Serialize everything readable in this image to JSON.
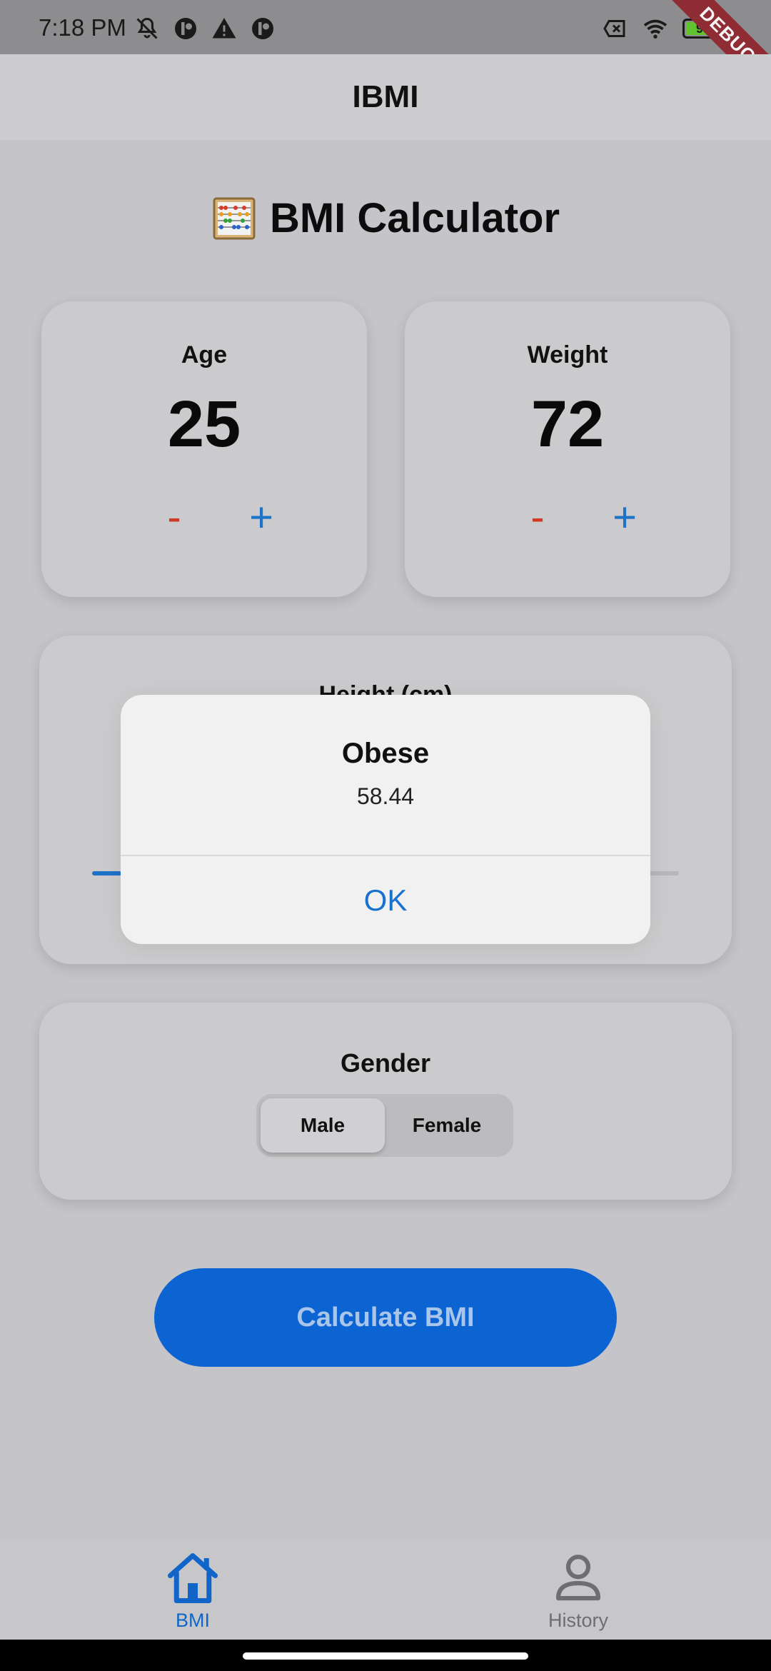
{
  "status_bar": {
    "time": "7:18 PM",
    "battery": "99",
    "battery_color": "#5ec32c",
    "left_icons": [
      "notifications-muted-icon",
      "app-notification-icon",
      "warning-icon",
      "app-notification-icon"
    ],
    "right_icons": [
      "no-sim-icon",
      "wifi-icon",
      "battery-icon"
    ]
  },
  "debug_banner": "DEBUG",
  "app_bar": {
    "title": "IBMI"
  },
  "page": {
    "title": "BMI Calculator",
    "title_icon": "abacus-icon"
  },
  "age_card": {
    "label": "Age",
    "value": "25",
    "minus_label": "-",
    "plus_label": "+"
  },
  "weight_card": {
    "label": "Weight",
    "value": "72",
    "minus_label": "-",
    "plus_label": "+"
  },
  "height_card": {
    "label": "Height (cm)",
    "slider_fraction": 0.05
  },
  "gender_card": {
    "label": "Gender",
    "options": [
      "Male",
      "Female"
    ],
    "selected": "Male"
  },
  "calculate_button": {
    "label": "Calculate BMI"
  },
  "dialog": {
    "title": "Obese",
    "message": "58.44",
    "ok_label": "OK"
  },
  "bottom_nav": {
    "items": [
      {
        "label": "BMI",
        "icon": "home-icon",
        "active": true
      },
      {
        "label": "History",
        "icon": "person-icon",
        "active": false
      }
    ]
  },
  "colors": {
    "accent": "#0b64d2",
    "minus": "#cf3a26",
    "plus": "#1d73c8",
    "dialog_action": "#1a72cf"
  }
}
